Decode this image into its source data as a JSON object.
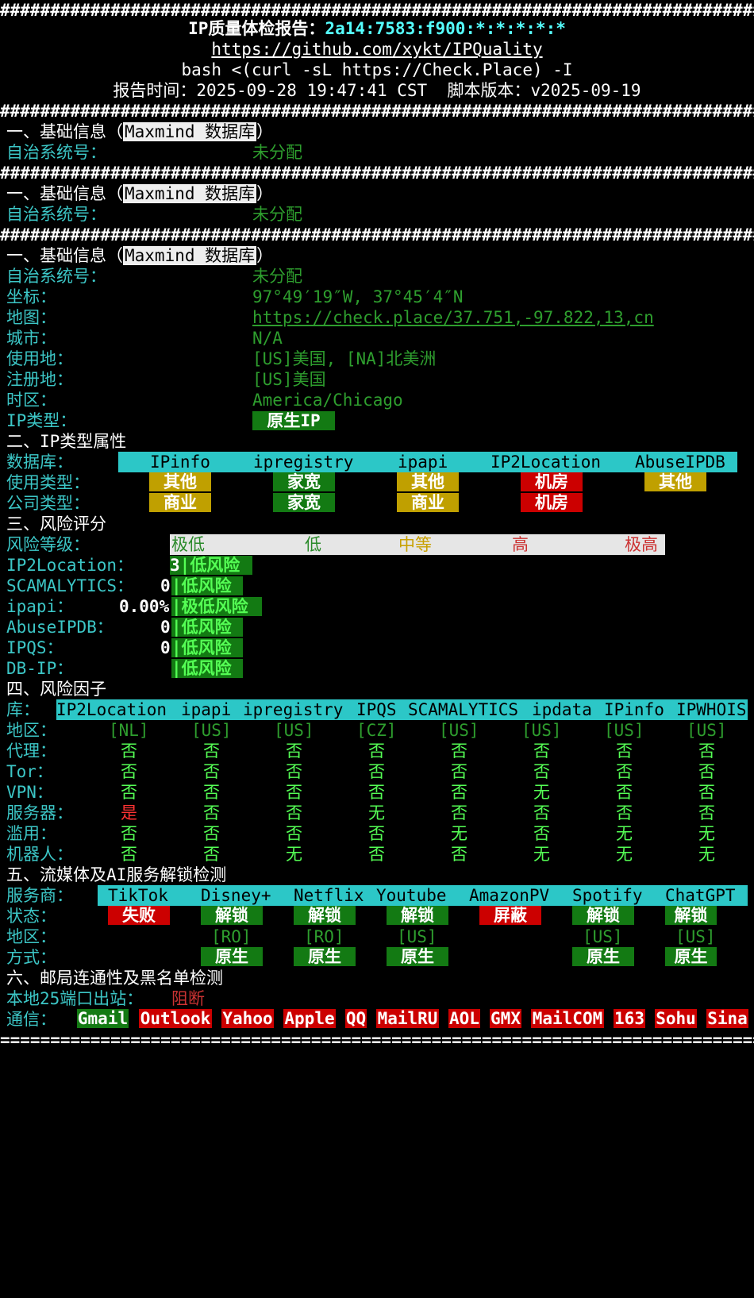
{
  "header": {
    "hash_line": "############################################################################",
    "title_prefix": "IP质量体检报告：",
    "ip": "2a14:7583:f900:*:*:*:*:*",
    "repo_url": "https://github.com/xykt/IPQuality",
    "command": "bash <(curl -sL https://Check.Place) -I",
    "report_time_label": "报告时间：",
    "report_time": "2025-09-28 19:47:41 CST",
    "version_label": "脚本版本：",
    "version": "v2025-09-19"
  },
  "basic": {
    "section_prefix": "一、基础信息（",
    "db_name": "Maxmind 数据库",
    "section_suffix": "）",
    "asn_label": "自治系统号：",
    "asn_value": "未分配",
    "coord_label": "坐标：",
    "coord_value": "97°49′19″W, 37°45′4″N",
    "map_label": "地图：",
    "map_value": "https://check.place/37.751,-97.822,13,cn",
    "city_label": "城市：",
    "city_value": "N/A",
    "usage_label": "使用地：",
    "usage_value": "[US]美国, [NA]北美洲",
    "reg_label": "注册地：",
    "reg_value": "[US]美国",
    "tz_label": "时区：",
    "tz_value": "America/Chicago",
    "iptype_label": "IP类型：",
    "iptype_value": "原生IP"
  },
  "iptype": {
    "title": "二、IP类型属性",
    "db_label": "数据库：",
    "dbs": [
      "IPinfo",
      "ipregistry",
      "ipapi",
      "IP2Location",
      "AbuseIPDB"
    ],
    "usage_label": "使用类型：",
    "usage": [
      {
        "text": "其他",
        "color": "#c0a000"
      },
      {
        "text": "家宽",
        "color": "#137a13"
      },
      {
        "text": "其他",
        "color": "#c0a000"
      },
      {
        "text": "机房",
        "color": "#cc0000"
      },
      {
        "text": "其他",
        "color": "#c0a000"
      }
    ],
    "company_label": "公司类型：",
    "company": [
      {
        "text": "商业",
        "color": "#c0a000"
      },
      {
        "text": "家宽",
        "color": "#137a13"
      },
      {
        "text": "商业",
        "color": "#c0a000"
      },
      {
        "text": "机房",
        "color": "#cc0000"
      }
    ]
  },
  "risk": {
    "title": "三、风险评分",
    "level_label": "风险等级：",
    "levels": [
      "极低",
      "低",
      "中等",
      "高",
      "极高"
    ],
    "rows": [
      {
        "label": "IP2Location：",
        "score": "3",
        "text": "低风险"
      },
      {
        "label": "SCAMALYTICS：",
        "score": "0",
        "text": "低风险"
      },
      {
        "label": "ipapi：",
        "score": "0.00%",
        "text": "极低风险"
      },
      {
        "label": "AbuseIPDB：",
        "score": "0",
        "text": "低风险"
      },
      {
        "label": "IPQS：",
        "score": "0",
        "text": "低风险"
      },
      {
        "label": "DB-IP：",
        "score": "",
        "text": "低风险"
      }
    ]
  },
  "factors": {
    "title": "四、风险因子",
    "db_label": "库：",
    "dbs": [
      "IP2Location",
      "ipapi",
      "ipregistry",
      "IPQS",
      "SCAMALYTICS",
      "ipdata",
      "IPinfo",
      "IPWHOIS"
    ],
    "rows": [
      {
        "label": "地区：",
        "values": [
          "[NL]",
          "[US]",
          "[US]",
          "[CZ]",
          "[US]",
          "[US]",
          "[US]",
          "[US]"
        ]
      },
      {
        "label": "代理：",
        "values": [
          "否",
          "否",
          "否",
          "否",
          "否",
          "否",
          "否",
          "否"
        ]
      },
      {
        "label": "Tor：",
        "values": [
          "否",
          "否",
          "否",
          "否",
          "否",
          "否",
          "否",
          "否"
        ]
      },
      {
        "label": "VPN：",
        "values": [
          "否",
          "否",
          "否",
          "否",
          "否",
          "无",
          "否",
          "否"
        ]
      },
      {
        "label": "服务器：",
        "values": [
          "是",
          "否",
          "否",
          "无",
          "否",
          "否",
          "否",
          "否"
        ]
      },
      {
        "label": "滥用：",
        "values": [
          "否",
          "否",
          "否",
          "否",
          "无",
          "否",
          "无",
          "无"
        ]
      },
      {
        "label": "机器人：",
        "values": [
          "否",
          "否",
          "无",
          "否",
          "否",
          "无",
          "无",
          "无"
        ]
      }
    ]
  },
  "media": {
    "title": "五、流媒体及AI服务解锁检测",
    "provider_label": "服务商：",
    "providers": [
      "TikTok",
      "Disney+",
      "Netflix",
      "Youtube",
      "AmazonPV",
      "Spotify",
      "ChatGPT"
    ],
    "status_label": "状态：",
    "status": [
      {
        "text": "失败",
        "color": "#cc0000"
      },
      {
        "text": "解锁",
        "color": "#137a13"
      },
      {
        "text": "解锁",
        "color": "#137a13"
      },
      {
        "text": "解锁",
        "color": "#137a13"
      },
      {
        "text": "屏蔽",
        "color": "#cc0000"
      },
      {
        "text": "解锁",
        "color": "#137a13"
      },
      {
        "text": "解锁",
        "color": "#137a13"
      }
    ],
    "region_label": "地区：",
    "regions": [
      "",
      "[RO]",
      "[RO]",
      "[US]",
      "",
      "[US]",
      "[US]"
    ],
    "method_label": "方式：",
    "methods": [
      "",
      "原生",
      "原生",
      "原生",
      "",
      "原生",
      "原生"
    ]
  },
  "mail": {
    "title": "六、邮局连通性及黑名单检测",
    "port_label": "本地25端口出站：",
    "port_value": "阻断",
    "comm_label": "通信：",
    "services": [
      {
        "text": "Gmail",
        "color": "#137a13"
      },
      {
        "text": "Outlook",
        "color": "#cc0000"
      },
      {
        "text": "Yahoo",
        "color": "#cc0000"
      },
      {
        "text": "Apple",
        "color": "#cc0000"
      },
      {
        "text": "QQ",
        "color": "#cc0000"
      },
      {
        "text": "MailRU",
        "color": "#cc0000"
      },
      {
        "text": "AOL",
        "color": "#cc0000"
      },
      {
        "text": "GMX",
        "color": "#cc0000"
      },
      {
        "text": "MailCOM",
        "color": "#cc0000"
      },
      {
        "text": "163",
        "color": "#cc0000"
      },
      {
        "text": "Sohu",
        "color": "#cc0000"
      },
      {
        "text": "Sina",
        "color": "#cc0000"
      }
    ]
  },
  "footer": {
    "equals_line": "============================================================================"
  }
}
